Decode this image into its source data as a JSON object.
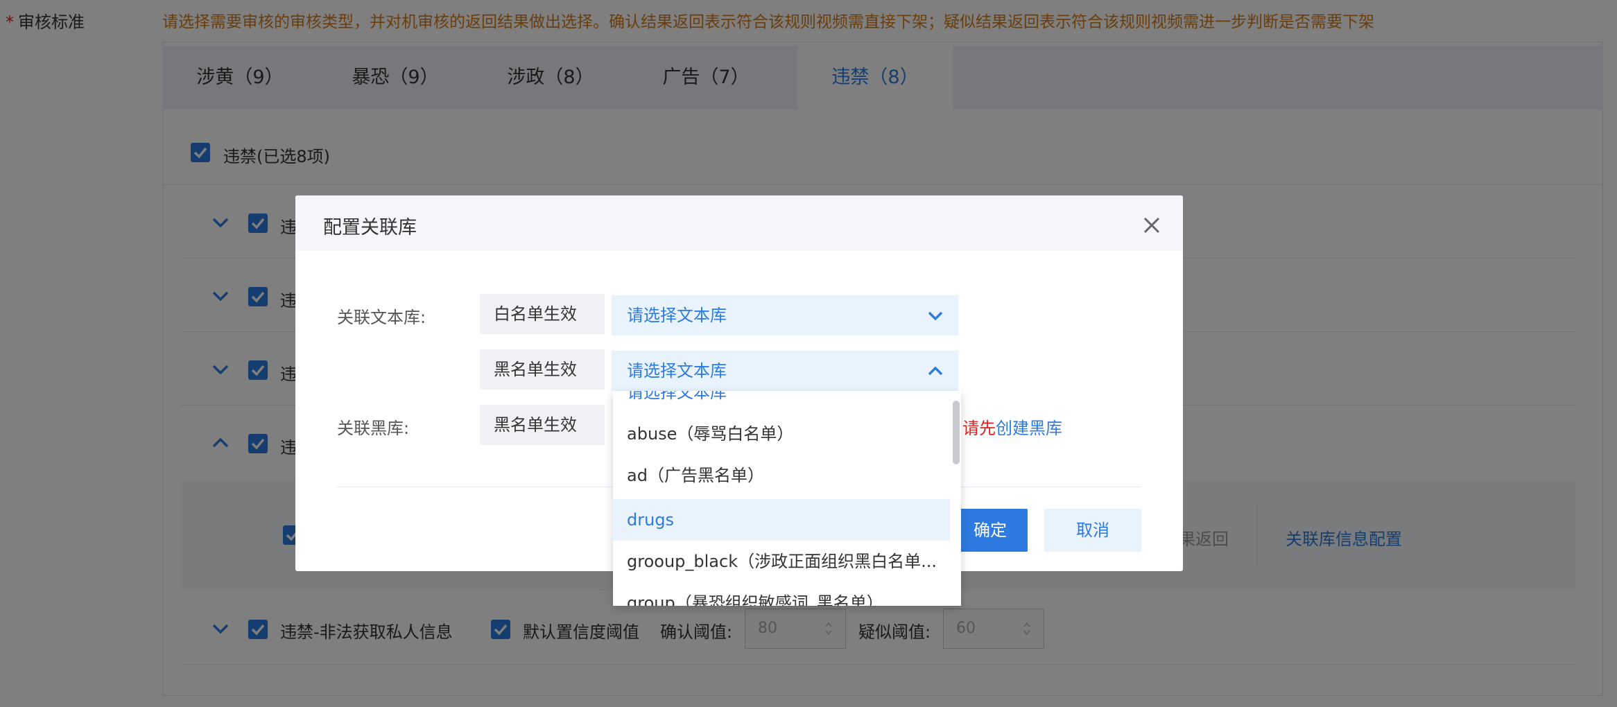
{
  "form": {
    "required_mark": "*",
    "label": "审核标准",
    "hint": "请选择需要审核的审核类型，并对机审核的返回结果做出选择。确认结果返回表示符合该规则视频需直接下架；疑似结果返回表示符合该规则视频需进一步判断是否需要下架"
  },
  "tabs": [
    {
      "label": "涉黄（9）",
      "active": false
    },
    {
      "label": "暴恐（9）",
      "active": false
    },
    {
      "label": "涉政（8）",
      "active": false
    },
    {
      "label": "广告（7）",
      "active": false
    },
    {
      "label": "违禁（8）",
      "active": true
    }
  ],
  "section": {
    "select_all_label": "违禁(已选8项)",
    "row_prefix": "违",
    "sub_result_text": "果返回",
    "sub_link": "关联库信息配置",
    "last_row": {
      "label": "违禁-非法获取私人信息",
      "default_threshold_label": "默认置信度阈值",
      "confirm_label": "确认阈值:",
      "confirm_value": "80",
      "suspect_label": "疑似阈值:",
      "suspect_value": "60"
    }
  },
  "modal": {
    "title": "配置关联库",
    "text_lib_label": "关联文本库:",
    "black_lib_label": "关联黑库:",
    "whitelist_tag": "白名单生效",
    "blacklist_tag": "黑名单生效",
    "blacklist_tag_2": "黑名单生效",
    "select_placeholder_1": "请选择文本库",
    "select_placeholder_2": "请选择文本库",
    "create_hint_red": "请先",
    "create_hint_link": "创建黑库",
    "ok_label": "确定",
    "cancel_label": "取消"
  },
  "dropdown": {
    "options": [
      {
        "label": "请选择文本库",
        "state": "placeholder"
      },
      {
        "label": "abuse（辱骂白名单）",
        "state": "normal"
      },
      {
        "label": "ad（广告黑名单）",
        "state": "normal"
      },
      {
        "label": "drugs",
        "state": "selected"
      },
      {
        "label": "grooup_black（涉政正面组织黑白名单...",
        "state": "normal"
      },
      {
        "label": "group（暴恐组织敏感词_黑名单）",
        "state": "normal"
      }
    ]
  },
  "colors": {
    "primary": "#2d7ae0",
    "hint_orange": "#d47a1a",
    "required_red": "#e02020",
    "mask": "rgba(0,0,0,0.5)"
  }
}
